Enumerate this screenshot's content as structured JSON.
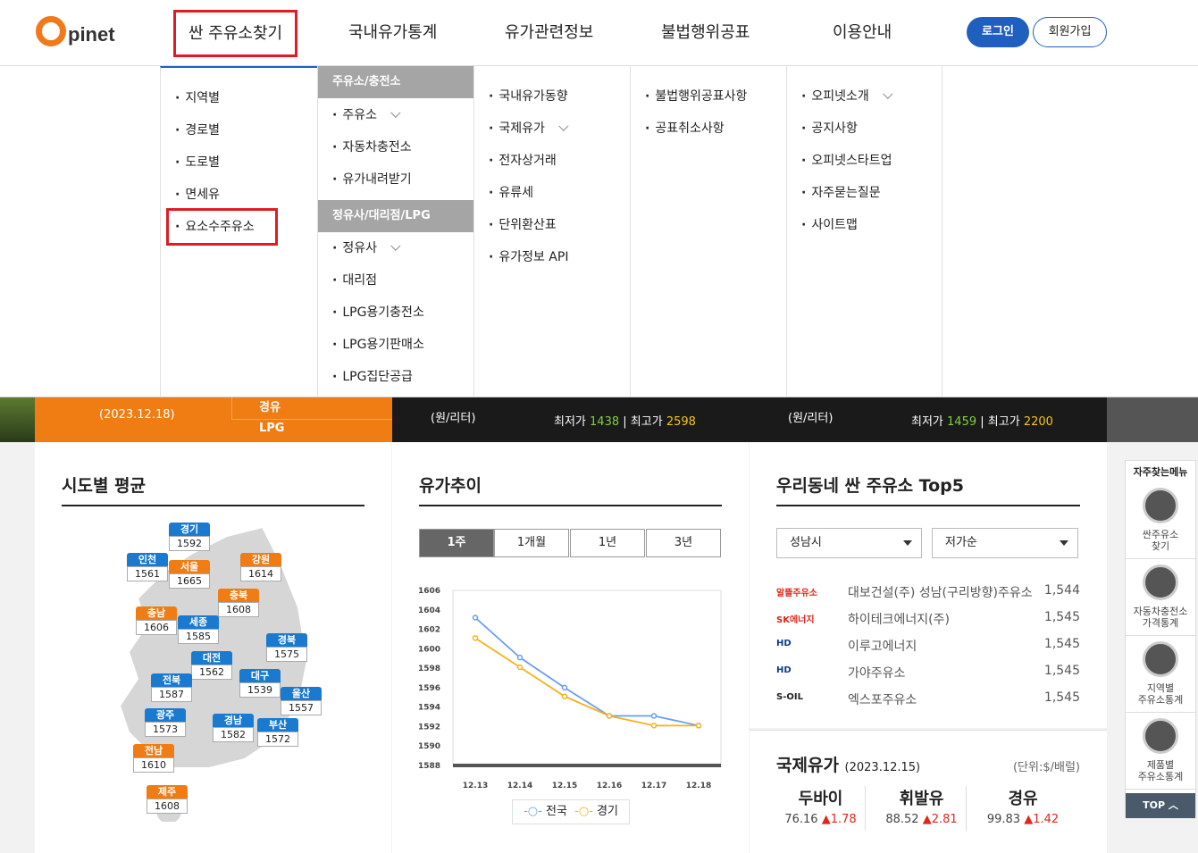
{
  "header": {
    "logo": "pinet",
    "nav": [
      "싼 주유소찾기",
      "국내유가통계",
      "유가관련정보",
      "불법행위공표",
      "이용안내"
    ],
    "login": "로그인",
    "join": "회원가입"
  },
  "dropdown": {
    "col1": [
      "지역별",
      "경로별",
      "도로별",
      "면세유",
      "요소수주유소"
    ],
    "col2_hdr1": "주유소/충전소",
    "col2a": [
      "주유소",
      "자동차충전소",
      "유가내려받기"
    ],
    "col2_hdr2": "정유사/대리점/LPG",
    "col2b": [
      "정유사",
      "대리점",
      "LPG용기충전소",
      "LPG용기판매소",
      "LPG집단공급"
    ],
    "col3": [
      "국내유가동향",
      "국제유가",
      "전자상거래",
      "유류세",
      "단위환산표",
      "유가정보 API"
    ],
    "col4": [
      "불법행위공표사항",
      "공표취소사항"
    ],
    "col5": [
      "오피넷소개",
      "공지사항",
      "오피넷스타트업",
      "자주묻는질문",
      "사이트맵"
    ]
  },
  "strip": {
    "date": "(2023.12.18)",
    "fuel1": "경유",
    "fuel2": "LPG",
    "unit1": "(원/리터)",
    "unit2": "(원/리터)",
    "min_label": "최저가",
    "max_label": "최고가",
    "min1": "1438",
    "max1": "2598",
    "min2": "1459",
    "max2": "2200",
    "sep": "|"
  },
  "map": {
    "title": "시도별 평균",
    "regions": [
      {
        "n": "경기",
        "v": "1592",
        "c": "blue"
      },
      {
        "n": "인천",
        "v": "1561",
        "c": "blue"
      },
      {
        "n": "서울",
        "v": "1665",
        "c": "org"
      },
      {
        "n": "강원",
        "v": "1614",
        "c": "org"
      },
      {
        "n": "충북",
        "v": "1608",
        "c": "org"
      },
      {
        "n": "충남",
        "v": "1606",
        "c": "org"
      },
      {
        "n": "세종",
        "v": "1585",
        "c": "blue"
      },
      {
        "n": "경북",
        "v": "1575",
        "c": "blue"
      },
      {
        "n": "대전",
        "v": "1562",
        "c": "blue"
      },
      {
        "n": "전북",
        "v": "1587",
        "c": "blue"
      },
      {
        "n": "대구",
        "v": "1539",
        "c": "blue"
      },
      {
        "n": "울산",
        "v": "1557",
        "c": "blue"
      },
      {
        "n": "광주",
        "v": "1573",
        "c": "blue"
      },
      {
        "n": "경남",
        "v": "1582",
        "c": "blue"
      },
      {
        "n": "부산",
        "v": "1572",
        "c": "blue"
      },
      {
        "n": "전남",
        "v": "1610",
        "c": "org"
      },
      {
        "n": "제주",
        "v": "1608",
        "c": "org"
      }
    ]
  },
  "trend": {
    "title": "유가추이",
    "tabs": [
      "1주",
      "1개월",
      "1년",
      "3년"
    ],
    "legend": [
      "전국",
      "경기"
    ]
  },
  "chart_data": {
    "type": "line",
    "x": [
      "12.13",
      "12.14",
      "12.15",
      "12.16",
      "12.17",
      "12.18"
    ],
    "ylim": [
      1588,
      1606
    ],
    "yticks": [
      1606,
      1604,
      1602,
      1600,
      1598,
      1596,
      1594,
      1592,
      1590,
      1588
    ],
    "series": [
      {
        "name": "전국",
        "color": "#6a9ef0",
        "values": [
          1603.2,
          1599.1,
          1596.0,
          1593.1,
          1593.1,
          1592.1
        ]
      },
      {
        "name": "경기",
        "color": "#f5b21a",
        "values": [
          1601.1,
          1598.1,
          1595.1,
          1593.1,
          1592.1,
          1592.1
        ]
      }
    ]
  },
  "top5": {
    "title": "우리동네 싼 주유소 Top5",
    "city": "성남시",
    "sort": "저가순",
    "items": [
      {
        "brand": "알뜰주유소",
        "name": "대보건설(주) 성남(구리방향)주유소",
        "price": "1,544"
      },
      {
        "brand": "SK에너지",
        "name": "하이테크에너지(주)",
        "price": "1,545"
      },
      {
        "brand": "HD",
        "name": "이루고에너지",
        "price": "1,545"
      },
      {
        "brand": "HD",
        "name": "가야주유소",
        "price": "1,545"
      },
      {
        "brand": "S-OIL",
        "name": "엑스포주유소",
        "price": "1,545"
      }
    ]
  },
  "intl": {
    "title": "국제유가",
    "date": "(2023.12.15)",
    "unit": "(단위:$/배럴)",
    "items": [
      {
        "name": "두바이",
        "v": "76.16",
        "d": "▲1.78"
      },
      {
        "name": "휘발유",
        "v": "88.52",
        "d": "▲2.81"
      },
      {
        "name": "경유",
        "v": "99.83",
        "d": "▲1.42"
      }
    ]
  },
  "quick": {
    "title": "자주찾는메뉴",
    "items": [
      "싼주유소\n찾기",
      "자동차충전소\n가격통계",
      "지역별\n주유소통계",
      "제품별\n주유소통계"
    ],
    "top": "TOP"
  }
}
